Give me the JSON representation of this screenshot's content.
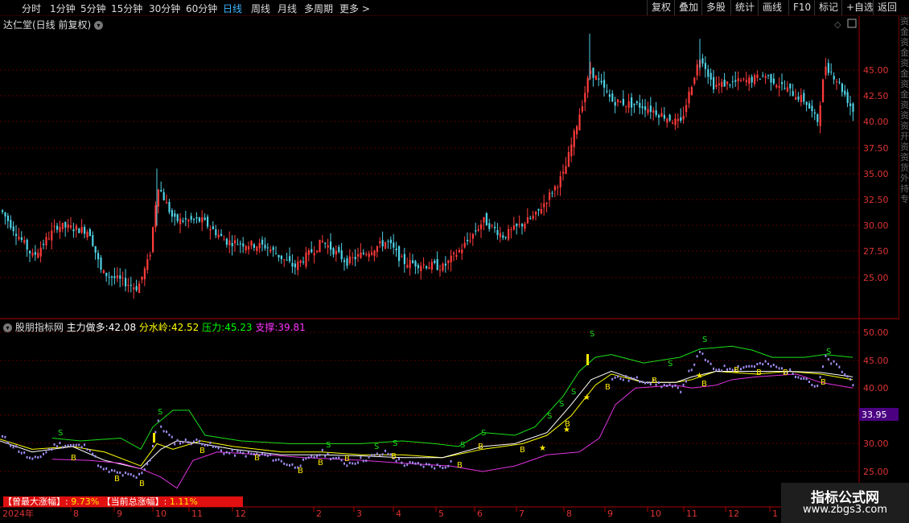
{
  "topbar": {
    "left_tabs": [
      "分时",
      "1分钟",
      "5分钟",
      "15分钟",
      "30分钟",
      "60分钟",
      "日线",
      "周线",
      "月线",
      "多周期",
      "更多 >"
    ],
    "active_tab": "日线",
    "right_buttons": [
      "复权",
      "叠加",
      "多股",
      "统计",
      "画线",
      "F10",
      "标记",
      "+自选",
      "返回"
    ]
  },
  "main_pane": {
    "title": "达仁堂(日线 前复权)",
    "price_ticks": [
      "45.00",
      "42.50",
      "40.00",
      "37.50",
      "35.00",
      "32.50",
      "30.00",
      "27.50",
      "25.00"
    ]
  },
  "indicator_pane": {
    "name": "股朋指标网",
    "line1_label": "主力做多:",
    "line1_value": "42.08",
    "line2_label": "分水岭:",
    "line2_value": "42.52",
    "line3_label": "压力:",
    "line3_value": "45.23",
    "line4_label": "支撑:",
    "line4_value": "39.81",
    "ticks": [
      "50.00",
      "45.00",
      "40.00",
      "30.00",
      "25.00"
    ],
    "current_price": "33.95",
    "colors": {
      "line1": "#ffffff",
      "line2": "#ffff00",
      "line3": "#00ff00",
      "line4": "#ff33ff",
      "badge": "#4b0082"
    }
  },
  "stats_bar": {
    "label1": "【曾最大涨幅】:",
    "value1": "9.73%",
    "label2": "【当前总涨幅】:",
    "value2": "1.11%"
  },
  "timeline": {
    "labels": [
      "2024年",
      "8",
      "9",
      "10",
      "11",
      "12",
      "2",
      "3",
      "4",
      "5",
      "6",
      "7",
      "8",
      "9",
      "10",
      "11",
      "12",
      "1"
    ]
  },
  "sidebar": {
    "chars": [
      "资",
      "金",
      "资",
      "金",
      "资",
      "金",
      "资",
      "金",
      "资",
      "资",
      "资",
      "开",
      "资",
      "资",
      "货",
      "外",
      "持",
      "专"
    ]
  },
  "watermark": {
    "title": "指标公式网",
    "url": "www.zbgs3.com"
  }
}
